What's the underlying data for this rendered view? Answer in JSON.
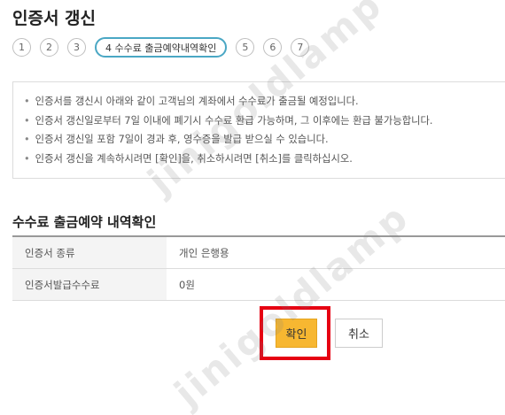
{
  "page": {
    "title": "인증서 갱신"
  },
  "steps": [
    {
      "label": "1"
    },
    {
      "label": "2"
    },
    {
      "label": "3"
    },
    {
      "label": "4 수수료 출금예약내역확인"
    },
    {
      "label": "5"
    },
    {
      "label": "6"
    },
    {
      "label": "7"
    }
  ],
  "notice": {
    "bullet": "•",
    "items": [
      "인증서를 갱신시 아래와 같이 고객님의 계좌에서 수수료가 출금될 예정입니다.",
      "인증서 갱신일로부터 7일 이내에 폐기시 수수료 환급 가능하며, 그 이후에는 환급 불가능합니다.",
      "인증서 갱신일 포함 7일이 경과 후, 영수증을 발급 받으실 수 있습니다.",
      "인증서 갱신을 계속하시려면 [확인]을, 취소하시려면 [취소]를 클릭하십시오."
    ]
  },
  "section": {
    "title": "수수료 출금예약 내역확인"
  },
  "table": {
    "rows": [
      {
        "label": "인증서 종류",
        "value": "개인 은행용"
      },
      {
        "label": "인증서발급수수료",
        "value": "0원"
      }
    ]
  },
  "buttons": {
    "confirm": "확인",
    "cancel": "취소"
  },
  "watermark": "jinigoldlamp",
  "colors": {
    "accent": "#4aa7c4",
    "confirm": "#f7b731",
    "highlight": "#e60012"
  }
}
